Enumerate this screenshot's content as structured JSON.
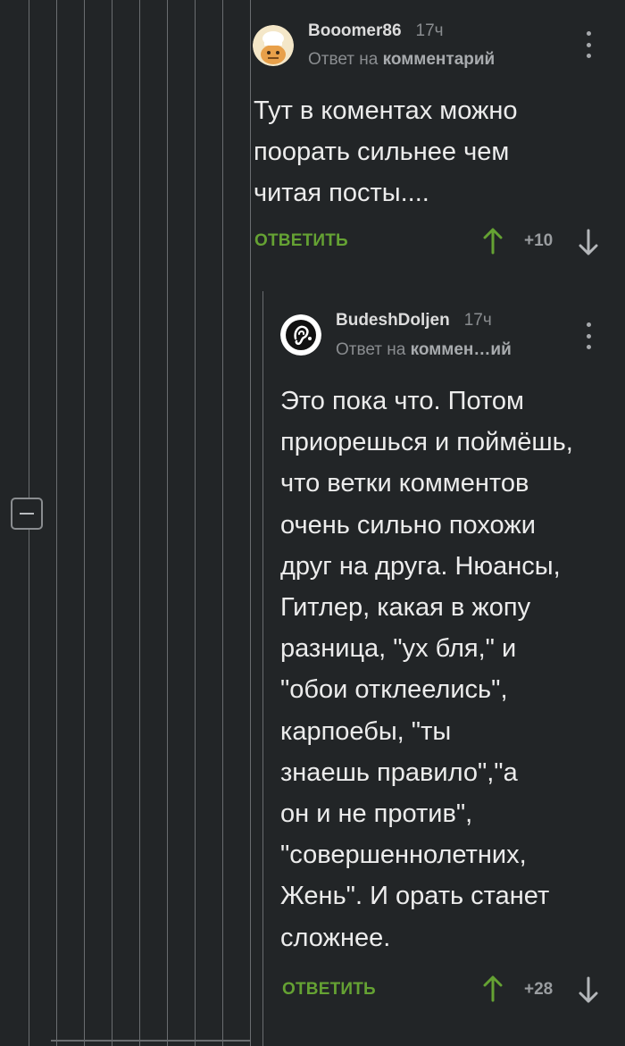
{
  "comments": [
    {
      "author": "Booomer86",
      "time": "17ч",
      "reply_prefix": "Ответ на",
      "reply_target": "комментарий",
      "text": "Тут в коментах можно\nпоорать сильнее чем\nчитая посты....",
      "reply_label": "ОТВЕТИТЬ",
      "score": "+10",
      "avatar_icon": "chef-avatar-icon"
    },
    {
      "author": "BudeshDoljen",
      "time": "17ч",
      "reply_prefix": "Ответ на",
      "reply_target": "коммен…ий",
      "text": "Это пока что. Потом\nприорешься и поймёшь,\nчто ветки комментов\nочень сильно похожи\nдруг на друга. Нюансы,\nГитлер, какая в жопу\nразница, \"ух бля,\" и\n\"обои отклеелись\",\nкарпоебы, \"ты\nзнаешь правило\",\"а\nон и не против\",\n\"совершеннолетних,\nЖень\". И орать станет\nсложнее.",
      "reply_label": "ОТВЕТИТЬ",
      "score": "+28",
      "avatar_icon": "ear-logo-avatar-icon"
    }
  ],
  "colors": {
    "background": "#222527",
    "accent_green": "#65a233",
    "thread_line": "#6a6d70"
  },
  "icons": {
    "collapse": "minus-icon",
    "more": "more-vertical-icon",
    "upvote": "arrow-up-icon",
    "downvote": "arrow-down-icon"
  }
}
